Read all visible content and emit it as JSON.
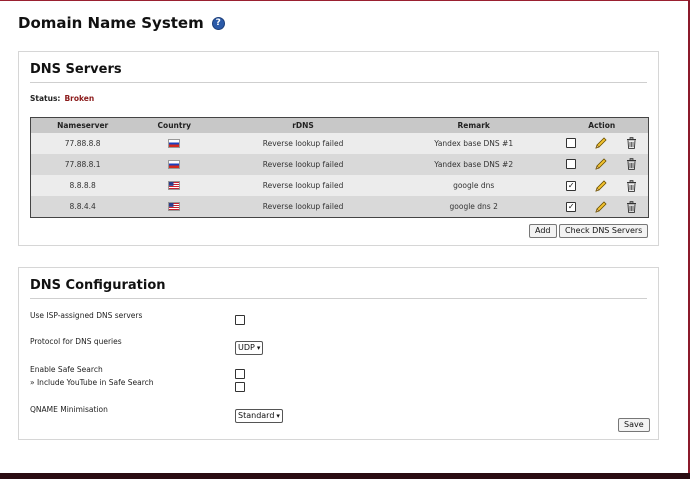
{
  "page": {
    "title": "Domain Name System",
    "help_icon": "help-icon"
  },
  "servers": {
    "title": "DNS Servers",
    "status_label": "Status:",
    "status_value": "Broken",
    "status_color": "#8b1a1a",
    "columns": [
      "Nameserver",
      "Country",
      "rDNS",
      "Remark",
      "Action"
    ],
    "rows": [
      {
        "nameserver": "77.88.8.8",
        "country": "RU",
        "rdns": "Reverse lookup failed",
        "remark": "Yandex base DNS #1",
        "checked": false
      },
      {
        "nameserver": "77.88.8.1",
        "country": "RU",
        "rdns": "Reverse lookup failed",
        "remark": "Yandex base DNS #2",
        "checked": false
      },
      {
        "nameserver": "8.8.8.8",
        "country": "US",
        "rdns": "Reverse lookup failed",
        "remark": "google dns",
        "checked": true
      },
      {
        "nameserver": "8.8.4.4",
        "country": "US",
        "rdns": "Reverse lookup failed",
        "remark": "google dns 2",
        "checked": true
      }
    ],
    "add_label": "Add",
    "check_label": "Check DNS Servers"
  },
  "config": {
    "title": "DNS Configuration",
    "isp_label": "Use ISP-assigned DNS servers",
    "isp_checked": false,
    "protocol_label": "Protocol for DNS queries",
    "protocol_value": "UDP",
    "safe_search_label": "Enable Safe Search",
    "safe_search_checked": false,
    "youtube_label": "» Include YouTube in Safe Search",
    "youtube_checked": false,
    "qname_label": "QNAME Minimisation",
    "qname_value": "Standard",
    "save_label": "Save"
  }
}
